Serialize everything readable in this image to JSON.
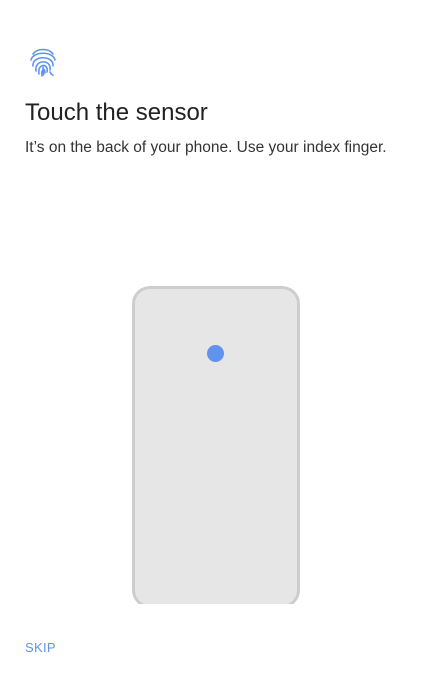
{
  "header": {
    "icon": "fingerprint-icon",
    "title": "Touch the sensor",
    "description": "It’s on the back of your phone. Use your index finger."
  },
  "illustration": {
    "device": "phone-back",
    "sensor_color": "#5f93ee"
  },
  "footer": {
    "skip_label": "SKIP"
  },
  "colors": {
    "accent": "#5f93ee",
    "phone_fill": "#e6e6e6",
    "phone_border": "#cdcdcd"
  }
}
